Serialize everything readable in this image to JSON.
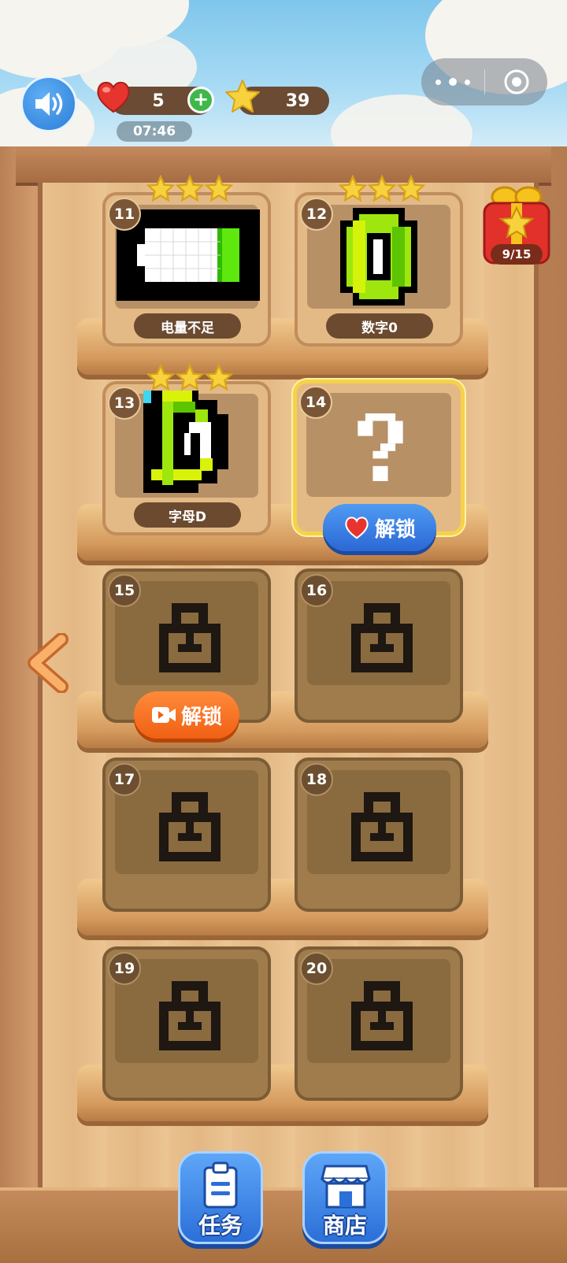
{
  "hud": {
    "lives": "5",
    "stars": "39",
    "timer": "07:46",
    "plus_label": "+"
  },
  "gift": {
    "progress": "9/15"
  },
  "levels": [
    {
      "number": "11",
      "name": "电量不足",
      "stars": 3,
      "status": "completed"
    },
    {
      "number": "12",
      "name": "数字0",
      "stars": 3,
      "status": "completed"
    },
    {
      "number": "13",
      "name": "字母D",
      "stars": 3,
      "status": "completed"
    },
    {
      "number": "14",
      "name": "",
      "stars": 0,
      "status": "unknown"
    },
    {
      "number": "15",
      "status": "locked"
    },
    {
      "number": "16",
      "status": "locked"
    },
    {
      "number": "17",
      "status": "locked"
    },
    {
      "number": "18",
      "status": "locked"
    },
    {
      "number": "19",
      "status": "locked"
    },
    {
      "number": "20",
      "status": "locked"
    }
  ],
  "buttons": {
    "unlock_heart": "解锁",
    "unlock_video": "解锁"
  },
  "dock": {
    "tasks": "任务",
    "shop": "商店"
  },
  "icons": [
    "sound-icon",
    "heart-icon",
    "star-icon",
    "more-icon",
    "close-circle-icon",
    "gift-icon",
    "lock-icon",
    "question-icon",
    "video-icon",
    "back-arrow-icon",
    "clipboard-icon",
    "shop-icon"
  ],
  "colors": {
    "accent_blue": "#2b6fd8",
    "accent_orange": "#f06014",
    "star_gold": "#f7d23c",
    "wood": "#e3ba86"
  }
}
